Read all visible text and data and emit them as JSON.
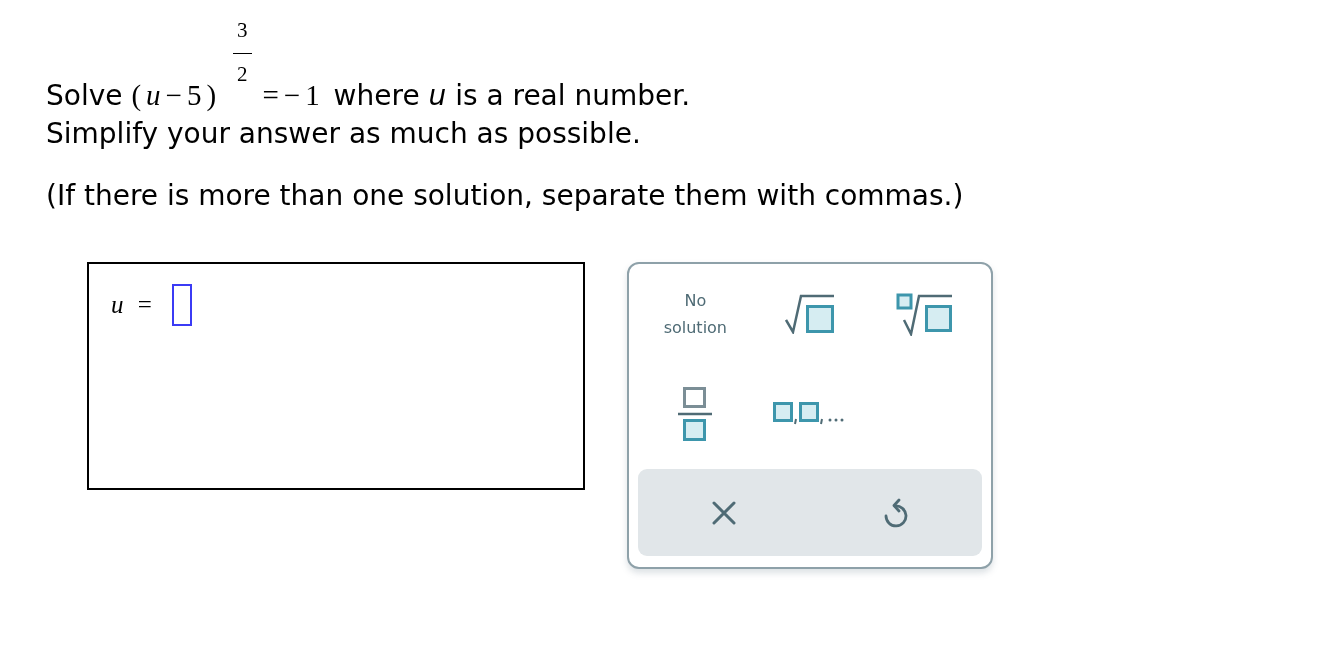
{
  "problem": {
    "statement": {
      "before": "Solve",
      "base": "(*u*−5)",
      "exponent_numerator": "3",
      "exponent_denominator": "2",
      "rhs": "=−1",
      "after": "where *u* is a real number."
    },
    "instruction": "Simplify your answer as much as possible.",
    "note": "(If there is more than one solution, separate them with commas.)"
  },
  "answer": {
    "label": "*u* ="
  },
  "keypad": {
    "keys": [
      {
        "kind": "text",
        "label": "No solution"
      },
      {
        "kind": "square_root"
      },
      {
        "kind": "nth_root"
      },
      {
        "kind": "fraction"
      },
      {
        "kind": "list"
      }
    ],
    "actions": [
      {
        "kind": "clear"
      },
      {
        "kind": "undo"
      }
    ]
  }
}
